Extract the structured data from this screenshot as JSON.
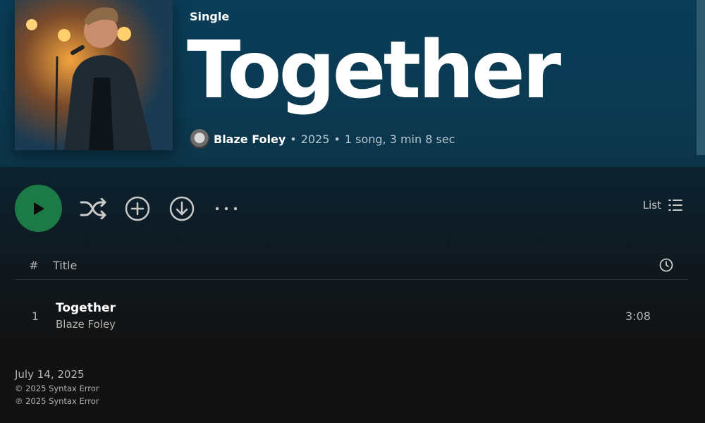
{
  "album": {
    "type": "Single",
    "title": "Together",
    "artist": "Blaze Foley",
    "year": "2025",
    "summary": "1 song, 3 min 8 sec"
  },
  "actions": {
    "view_label": "List"
  },
  "table": {
    "headers": {
      "num": "#",
      "title": "Title"
    },
    "tracks": [
      {
        "num": "1",
        "title": "Together",
        "artist": "Blaze Foley",
        "duration": "3:08"
      }
    ]
  },
  "footer": {
    "release_date": "July 14, 2025",
    "copyright": "© 2025 Syntax Error",
    "phonographic": "℗ 2025 Syntax Error"
  },
  "colors": {
    "accent": "#1b7a45",
    "hero": "#0a3d59",
    "background": "#121212"
  },
  "icons": [
    "play-icon",
    "shuffle-icon",
    "add-icon",
    "download-icon",
    "more-icon",
    "list-view-icon",
    "clock-icon"
  ]
}
